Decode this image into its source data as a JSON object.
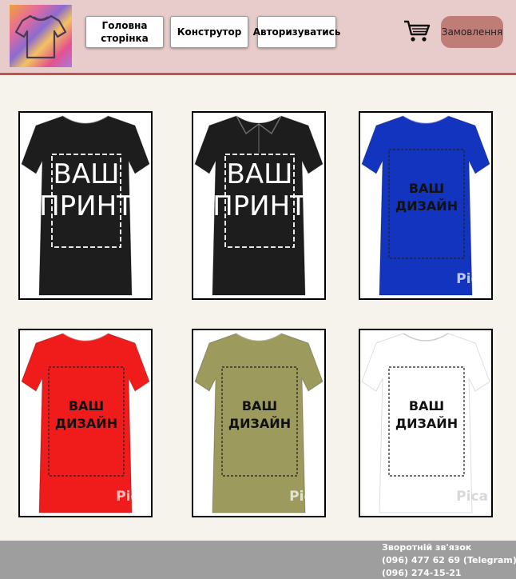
{
  "header": {
    "logo_icon": "tshirt-logo-icon",
    "nav": {
      "home_label_line1": "Головна",
      "home_label_line2": "сторінка",
      "constructor_label": "Конструтор",
      "login_label": "Авторизуватись"
    },
    "cart_icon": "shopping-cart-icon",
    "orders_label": "Замовлення"
  },
  "products": [
    {
      "color": "#1d1d1d",
      "style": "t-shirt",
      "print_line1": "ВАШ",
      "print_line2": "ПРИНТ",
      "watermark": ""
    },
    {
      "color": "#1d1d1d",
      "style": "polo",
      "print_line1": "ВАШ",
      "print_line2": "ПРИНТ",
      "watermark": ""
    },
    {
      "color": "#1334bf",
      "style": "t-shirt",
      "print_line1": "ВАШ",
      "print_line2": "ДИЗАЙН",
      "watermark": "Pica"
    },
    {
      "color": "#f01c1c",
      "style": "t-shirt",
      "print_line1": "ВАШ",
      "print_line2": "ДИЗАЙН",
      "watermark": "Pica"
    },
    {
      "color": "#9c9a5c",
      "style": "t-shirt",
      "print_line1": "ВАШ",
      "print_line2": "ДИЗАЙН",
      "watermark": "Pica"
    },
    {
      "color": "#ffffff",
      "style": "t-shirt",
      "print_line1": "ВАШ",
      "print_line2": "ДИЗАЙН",
      "watermark": "Pica"
    }
  ],
  "footer": {
    "feedback_title": "Зворотній зв'язок",
    "phone_telegram": "(096) 477 62 69 (Telegram)",
    "phone_2": "(096) 274-15-21"
  },
  "colors": {
    "header_bg": "#e8cccb",
    "header_border": "#c4504e",
    "orders_button": "#bf7d78",
    "page_bg": "#f6f3ec",
    "footer_bg": "#9e9e9e"
  }
}
